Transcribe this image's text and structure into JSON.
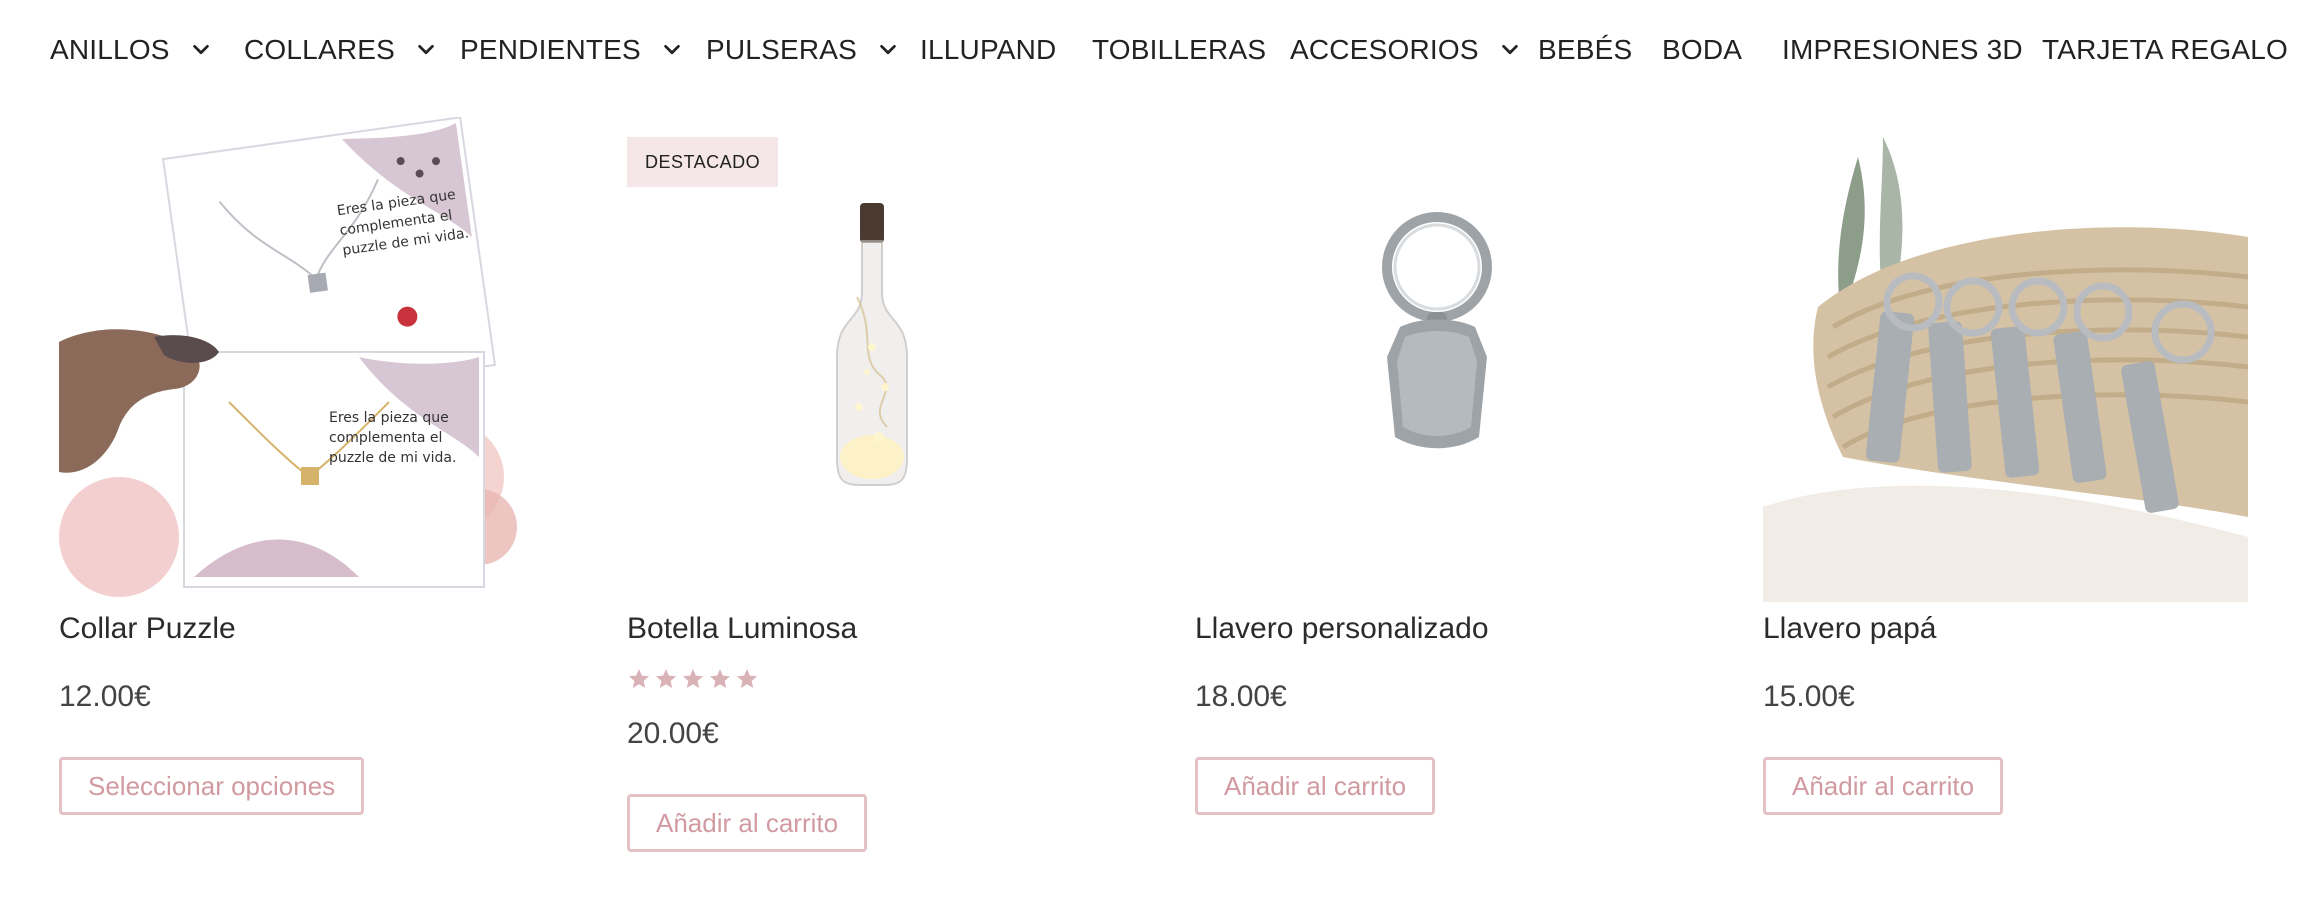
{
  "nav": {
    "items": [
      {
        "label": "ANILLOS",
        "has_dropdown": true
      },
      {
        "label": "COLLARES",
        "has_dropdown": true
      },
      {
        "label": "PENDIENTES",
        "has_dropdown": true
      },
      {
        "label": "PULSERAS",
        "has_dropdown": true
      },
      {
        "label": "ILLUPAND",
        "has_dropdown": false
      },
      {
        "label": "TOBILLERAS",
        "has_dropdown": false
      },
      {
        "label": "ACCESORIOS",
        "has_dropdown": true
      },
      {
        "label": "BEBÉS",
        "has_dropdown": false
      },
      {
        "label": "BODA",
        "has_dropdown": false
      },
      {
        "label": "IMPRESIONES 3D",
        "has_dropdown": false
      },
      {
        "label": "TARJETA REGALO",
        "has_dropdown": false
      }
    ]
  },
  "products": [
    {
      "title": "Collar Puzzle",
      "price": "12.00€",
      "button_label": "Seleccionar opciones",
      "badge": "",
      "rating": null
    },
    {
      "title": "Botella Luminosa",
      "price": "20.00€",
      "button_label": "Añadir al carrito",
      "badge": "DESTACADO",
      "rating": 5
    },
    {
      "title": "Llavero personalizado",
      "price": "18.00€",
      "button_label": "Añadir al carrito",
      "badge": "",
      "rating": null
    },
    {
      "title": "Llavero papá",
      "price": "15.00€",
      "button_label": "Añadir al carrito",
      "badge": "",
      "rating": null
    }
  ],
  "colors": {
    "accent": "#d19aa1",
    "button_border": "#e4c1c5",
    "badge_bg": "#f5e7e8",
    "text_dark": "#222222",
    "text_price": "#444444",
    "star_fill": "#d9b2b7"
  },
  "icons": {
    "nav_dropdown": "chevron-down-icon",
    "rating_star": "star-icon"
  }
}
